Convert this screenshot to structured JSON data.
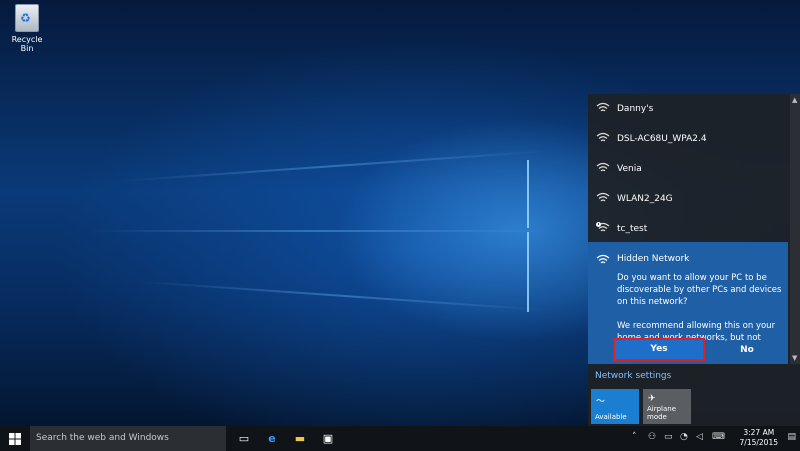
{
  "desktop": {
    "icons": [
      {
        "label": "Recycle Bin",
        "icon": "recycle-bin-icon"
      }
    ]
  },
  "flyout": {
    "networks": [
      {
        "name": "Danny's",
        "icon": "wifi-icon",
        "secured_warning": false
      },
      {
        "name": "DSL-AC68U_WPA2.4",
        "icon": "wifi-icon",
        "secured_warning": false
      },
      {
        "name": "Venia",
        "icon": "wifi-icon",
        "secured_warning": false
      },
      {
        "name": "WLAN2_24G",
        "icon": "wifi-icon",
        "secured_warning": false
      },
      {
        "name": "tc_test",
        "icon": "wifi-warning-icon",
        "secured_warning": true
      }
    ],
    "selected": {
      "name": "Hidden Network",
      "question": "Do you want to allow your PC to be discoverable by other PCs and devices on this network?",
      "recommendation": "We recommend allowing this on your home and work networks, but not public ones.",
      "yes_label": "Yes",
      "no_label": "No"
    },
    "network_settings_label": "Network settings",
    "tiles": [
      {
        "label": "Available",
        "icon": "wifi-icon",
        "active": true
      },
      {
        "label": "Airplane mode",
        "icon": "airplane-icon",
        "active": false
      }
    ]
  },
  "taskbar": {
    "search_placeholder": "Search the web and Windows",
    "apps": [
      "task-view-icon",
      "edge-icon",
      "file-explorer-icon",
      "store-icon"
    ],
    "tray_icons": [
      "chevron-up-icon",
      "people-icon",
      "battery-icon",
      "network-icon",
      "volume-icon",
      "keyboard-icon",
      "notifications-icon"
    ],
    "time": "3:27 AM",
    "date": "7/15/2015"
  },
  "colors": {
    "accent": "#1e5fa6",
    "tile_active": "#1b7fd1",
    "highlight_outline": "#e02020",
    "link": "#7ec0ff"
  }
}
